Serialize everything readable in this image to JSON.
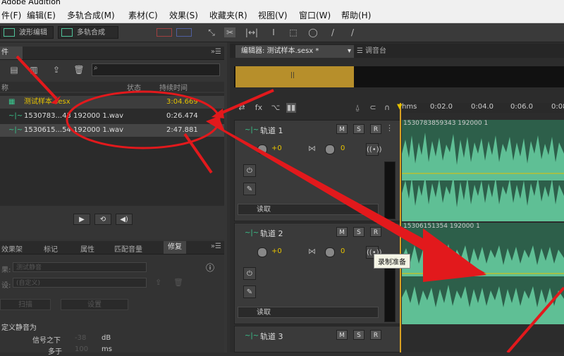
{
  "app": {
    "title": "Adobe Audition"
  },
  "menu": [
    "件(F)",
    "编辑(E)",
    "多轨合成(M)",
    "素材(C)",
    "效果(S)",
    "收藏夹(R)",
    "视图(V)",
    "窗口(W)",
    "帮助(H)"
  ],
  "toolbar": {
    "waveform_label": "波形编辑",
    "multitrack_label": "多轨合成"
  },
  "files_panel": {
    "tab_label": "件",
    "columns": {
      "name": "称",
      "status": "状态",
      "duration": "持续时间"
    },
    "files": [
      {
        "name": "测试样本.sesx",
        "duration": "3:04.669",
        "icon": "session-icon"
      },
      {
        "name": "1530783...43 192000 1.wav",
        "duration": "0:26.474",
        "icon": "waveform-icon"
      },
      {
        "name": "1530615...54 192000 1.wav",
        "duration": "2:47.881",
        "icon": "waveform-icon"
      }
    ]
  },
  "lower_panel": {
    "tabs": [
      "效果架",
      "标记",
      "属性",
      "匹配音量",
      "修复"
    ],
    "preset_label": "果:",
    "preset_value": "测试静音",
    "preset2_label": "设:",
    "preset2_value": "(自定义)",
    "scan_button": "扫描",
    "settings_button": "设置",
    "define_silence": "定义静音为",
    "signal_below": "信号之下",
    "signal_value": "-38",
    "signal_unit": "dB",
    "more_than": "多于",
    "more_value": "100",
    "more_unit": "ms"
  },
  "editor": {
    "tabs": [
      {
        "label": "编辑器: 测试样本.sesx *",
        "active": true
      },
      {
        "label": "调音台",
        "active": false
      }
    ],
    "ruler": [
      "hms",
      "0:02.0",
      "0:04.0",
      "0:06.0",
      "0:08"
    ],
    "tracks": [
      {
        "name": "轨道 1",
        "volume": "+0",
        "pan": "0",
        "read_mode": "读取",
        "clip": "1530783859343 192000 1"
      },
      {
        "name": "轨道 2",
        "volume": "+0",
        "pan": "0",
        "read_mode": "读取",
        "clip": "15306151354 192000 1"
      },
      {
        "name": "轨道 3"
      }
    ],
    "tooltip": "录制准备"
  },
  "colors": {
    "accent": "#b78f2b",
    "waveform": "#5fbf95",
    "annotation": "#e2191c"
  }
}
